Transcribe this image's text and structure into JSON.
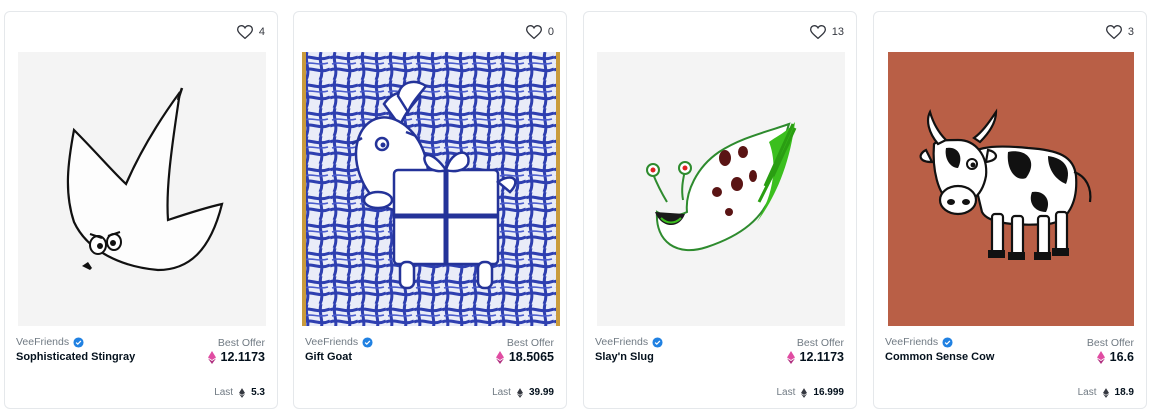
{
  "currency_icon": "ethereum-icon",
  "verified_icon": "verified-badge-icon",
  "colors": {
    "card_border": "#e5e8eb",
    "eth_pink": "#e04ca2",
    "verified_blue": "#2081e2",
    "cow_background": "#b95f46"
  },
  "cards": [
    {
      "favorites": "4",
      "collection": "VeeFriends",
      "name": "Sophisticated Stingray",
      "best_offer_label": "Best Offer",
      "best_offer": "12.1173",
      "last_label": "Last",
      "last_price": "5.3"
    },
    {
      "favorites": "0",
      "collection": "VeeFriends",
      "name": "Gift Goat",
      "best_offer_label": "Best Offer",
      "best_offer": "18.5065",
      "last_label": "Last",
      "last_price": "39.99"
    },
    {
      "favorites": "13",
      "collection": "VeeFriends",
      "name": "Slay'n Slug",
      "best_offer_label": "Best Offer",
      "best_offer": "12.1173",
      "last_label": "Last",
      "last_price": "16.999"
    },
    {
      "favorites": "3",
      "collection": "VeeFriends",
      "name": "Common Sense Cow",
      "best_offer_label": "Best Offer",
      "best_offer": "16.6",
      "last_label": "Last",
      "last_price": "18.9"
    }
  ]
}
